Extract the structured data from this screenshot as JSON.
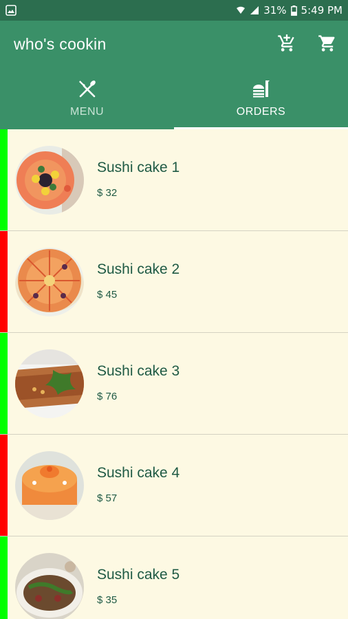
{
  "status_bar": {
    "battery": "31%",
    "time": "5:49 PM"
  },
  "app_bar": {
    "title": "who's cookin",
    "actions": [
      {
        "icon": "add-shopping-cart-icon"
      },
      {
        "icon": "shopping-cart-icon"
      }
    ]
  },
  "tabs": [
    {
      "label": "MENU",
      "icon": "fork-knife-icon",
      "selected": false
    },
    {
      "label": "ORDERS",
      "icon": "food-tray-icon",
      "selected": true
    }
  ],
  "colors": {
    "app_bar": "#3a9068",
    "status_bar": "#2c6e4f",
    "background": "#fdf9e3",
    "text": "#1f5a44",
    "status_green": "#00ff00",
    "status_red": "#ff0000"
  },
  "orders": [
    {
      "name": "Sushi cake 1",
      "price": "$ 32",
      "status_color": "#00ff00"
    },
    {
      "name": "Sushi cake 2",
      "price": "$ 45",
      "status_color": "#ff0000"
    },
    {
      "name": "Sushi cake 3",
      "price": "$ 76",
      "status_color": "#00ff00"
    },
    {
      "name": "Sushi cake 4",
      "price": "$ 57",
      "status_color": "#ff0000"
    },
    {
      "name": "Sushi cake 5",
      "price": "$ 35",
      "status_color": "#00ff00"
    }
  ]
}
